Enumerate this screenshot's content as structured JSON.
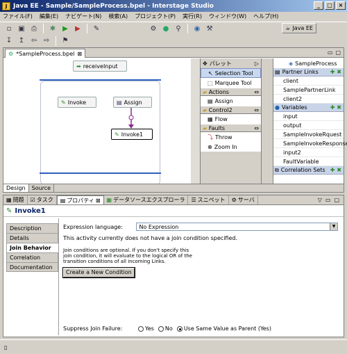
{
  "window": {
    "title": "Java EE - Sample/SampleProcess.bpel - Interstage Studio"
  },
  "menu": [
    "ファイル(F)",
    "編集(E)",
    "ナビゲート(N)",
    "検索(A)",
    "プロジェクト(P)",
    "実行(R)",
    "ウィンドウ(W)",
    "ヘルプ(H)"
  ],
  "perspective": {
    "label": "Java EE"
  },
  "editor": {
    "tab": "*SampleProcess.bpel",
    "nodes": {
      "receive": "receiveInput",
      "invoke": "Invoke",
      "assign": "Assign",
      "invoke1": "Invoke1"
    },
    "bottom_tabs": [
      "Design",
      "Source"
    ]
  },
  "palette": {
    "title": "パレット",
    "tools": [
      "Selection Tool",
      "Marquee Tool"
    ],
    "groups": [
      {
        "name": "Actions",
        "items": [
          "Assign"
        ]
      },
      {
        "name": "Control2",
        "items": [
          "Flow"
        ]
      },
      {
        "name": "Faults",
        "items": [
          "Throw",
          "Zoom In"
        ]
      }
    ]
  },
  "outline": {
    "root": "SampleProcess",
    "sections": [
      {
        "name": "Partner Links",
        "items": [
          "client",
          "SamplePartnerLink",
          "client2"
        ]
      },
      {
        "name": "Variables",
        "items": [
          "input",
          "output",
          "SampleInvokeRquest",
          "SampleInvokeResponse",
          "input2",
          "FaultVariable"
        ]
      },
      {
        "name": "Correlation Sets",
        "items": []
      }
    ]
  },
  "views": {
    "tabs": [
      "問題",
      "タスク",
      "プロパティ",
      "データソースエクスプローラ",
      "スニペット",
      "サーバ"
    ]
  },
  "properties": {
    "title": "Invoke1",
    "tabs": [
      "Description",
      "Details",
      "Join Behavior",
      "Correlation",
      "Documentation"
    ],
    "expression_label": "Expression language:",
    "expression_value": "No Expression",
    "note": "This activity currently does not have a join condition specified.",
    "help": [
      "Join conditions are optional.  If you don't specify this",
      "join condition, it will evaluate to the logical OR of the",
      "transition conditions of all incoming Links."
    ],
    "create_button": "Create a New Condition",
    "suppress_label": "Suppress Join Failure:",
    "suppress_options": [
      "Yes",
      "No",
      "Use Same Value as Parent (Yes)"
    ]
  }
}
